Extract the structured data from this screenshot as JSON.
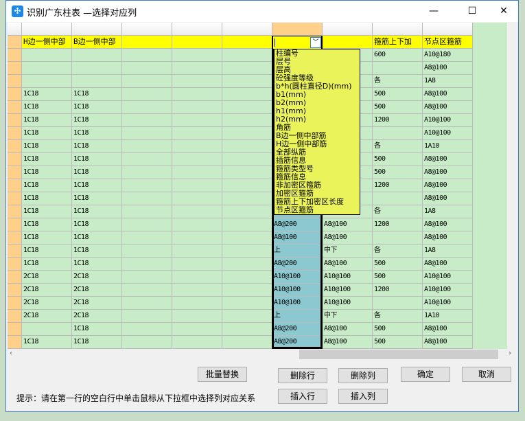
{
  "window": {
    "title": "识别广东柱表 —选择对应列",
    "minimize": "—",
    "maximize": "☐",
    "close": "✕"
  },
  "header_row": [
    "H边一侧中部",
    "B边一侧中部",
    "",
    "",
    "",
    "",
    "",
    "箍筋上下加",
    "节点区箍筋"
  ],
  "rows": [
    [
      "",
      "",
      "",
      "",
      "",
      "",
      "",
      "600",
      "A10@180"
    ],
    [
      "",
      "",
      "",
      "",
      "",
      "",
      "",
      "",
      "A8@100"
    ],
    [
      "",
      "",
      "",
      "",
      "",
      "",
      "",
      "各",
      "1A8"
    ],
    [
      "1C18",
      "1C18",
      "",
      "",
      "",
      "",
      "",
      "500",
      "A8@100"
    ],
    [
      "1C18",
      "1C18",
      "",
      "",
      "",
      "",
      "",
      "500",
      "A8@100"
    ],
    [
      "1C18",
      "1C18",
      "",
      "",
      "",
      "",
      "",
      "1200",
      "A10@100"
    ],
    [
      "1C18",
      "1C18",
      "",
      "",
      "",
      "",
      "",
      "",
      "A10@100"
    ],
    [
      "1C18",
      "1C18",
      "",
      "",
      "",
      "",
      "",
      "各",
      "1A10"
    ],
    [
      "1C18",
      "1C18",
      "",
      "",
      "",
      "",
      "",
      "500",
      "A8@100"
    ],
    [
      "1C18",
      "1C18",
      "",
      "",
      "",
      "",
      "",
      "500",
      "A8@100"
    ],
    [
      "1C18",
      "1C18",
      "",
      "",
      "",
      "",
      "",
      "1200",
      "A8@100"
    ],
    [
      "1C18",
      "1C18",
      "",
      "",
      "",
      "",
      "",
      "",
      "A8@100"
    ],
    [
      "1C18",
      "1C18",
      "",
      "",
      "",
      "",
      "",
      "各",
      "1A8"
    ],
    [
      "1C18",
      "1C18",
      "",
      "",
      "",
      "A8@200",
      "A8@100",
      "1200",
      "A8@100"
    ],
    [
      "1C18",
      "1C18",
      "",
      "",
      "",
      "A8@100",
      "A8@100",
      "",
      "A8@100"
    ],
    [
      "1C18",
      "1C18",
      "",
      "",
      "",
      "上",
      "中下",
      "各",
      "1A8"
    ],
    [
      "1C18",
      "1C18",
      "",
      "",
      "",
      "A8@200",
      "A8@100",
      "500",
      "A8@100"
    ],
    [
      "2C18",
      "2C18",
      "",
      "",
      "",
      "A10@100",
      "A10@100",
      "500",
      "A10@100"
    ],
    [
      "2C18",
      "2C18",
      "",
      "",
      "",
      "A10@100",
      "A10@100",
      "1200",
      "A10@100"
    ],
    [
      "2C18",
      "2C18",
      "",
      "",
      "",
      "A10@100",
      "A10@100",
      "",
      "A10@100"
    ],
    [
      "2C18",
      "2C18",
      "",
      "",
      "",
      "上",
      "中下",
      "各",
      "1A10"
    ],
    [
      "",
      "1C18",
      "",
      "",
      "",
      "A8@200",
      "A8@100",
      "500",
      "A8@100"
    ],
    [
      "1C18",
      "1C18",
      "",
      "",
      "",
      "A8@200",
      "A8@100",
      "500",
      "A8@100"
    ]
  ],
  "dropdown": {
    "value": "",
    "options": [
      "柱编号",
      "层号",
      "层高",
      "砼强度等级",
      "b*h(圆柱直径D)(mm)",
      "b1(mm)",
      "b2(mm)",
      "h1(mm)",
      "h2(mm)",
      "角筋",
      "B边一侧中部筋",
      "H边一侧中部筋",
      "全部纵筋",
      "插筋信息",
      "箍筋类型号",
      "箍筋信息",
      "非加密区箍筋",
      "加密区箍筋",
      "箍筋上下加密区长度",
      "节点区箍筋"
    ]
  },
  "buttons": {
    "batch_replace": "批量替换",
    "delete_row": "删除行",
    "delete_col": "删除列",
    "ok": "确定",
    "cancel": "取消",
    "insert_row": "插入行",
    "insert_col": "插入列"
  },
  "hint": "提示：请在第一行的空白行中单击鼠标从下拉框中选择列对应关系",
  "colors": {
    "header_yellow": "#ffff00",
    "cell_green": "#c8ecc8",
    "selected_col": "#8cc8d0",
    "row_header": "#ffd08a",
    "dropdown_bg": "#eaf35a"
  }
}
